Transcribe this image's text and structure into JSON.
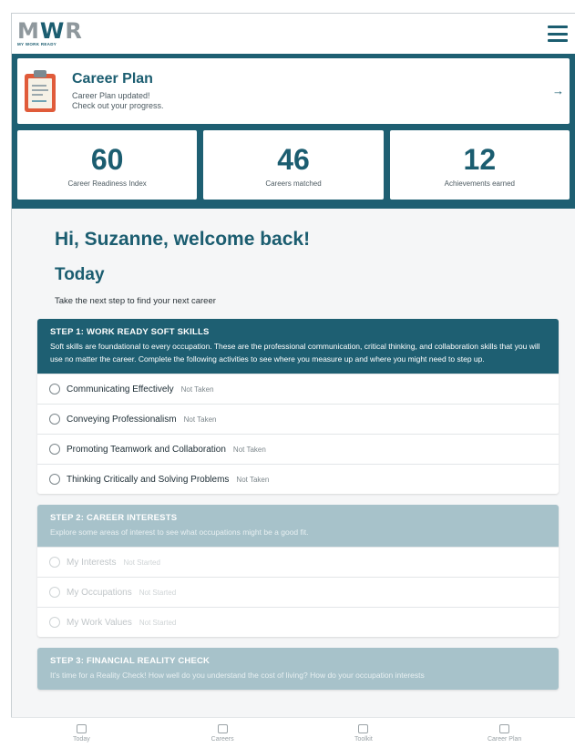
{
  "header": {
    "logo_mark_m": "M",
    "logo_mark_w": "W",
    "logo_mark_r": "R",
    "logo_sub": "MY WORK READY",
    "menu_icon": "hamburger-icon"
  },
  "career_plan": {
    "title": "Career Plan",
    "line1": "Career Plan updated!",
    "line2": "Check out your progress.",
    "arrow": "→"
  },
  "stats": [
    {
      "value": "60",
      "label": "Career Readiness Index"
    },
    {
      "value": "46",
      "label": "Careers matched"
    },
    {
      "value": "12",
      "label": "Achievements earned"
    }
  ],
  "greeting": "Hi, Suzanne, welcome back!",
  "today": {
    "title": "Today",
    "subtitle": "Take the next step to find your next career"
  },
  "steps": [
    {
      "title": "STEP 1: WORK READY SOFT SKILLS",
      "description": "Soft skills are foundational to every occupation. These are the professional communication, critical thinking, and collaboration skills that you will use no matter the career. Complete the following activities to see where you measure up and where you might need to step up.",
      "items": [
        {
          "label": "Communicating Effectively",
          "status": "Not Taken"
        },
        {
          "label": "Conveying Professionalism",
          "status": "Not Taken"
        },
        {
          "label": "Promoting Teamwork and Collaboration",
          "status": "Not Taken"
        },
        {
          "label": "Thinking Critically and Solving Problems",
          "status": "Not Taken"
        }
      ]
    },
    {
      "title": "STEP 2: CAREER INTERESTS",
      "description": "Explore some areas of interest to see what occupations might be a good fit.",
      "items": [
        {
          "label": "My Interests",
          "status": "Not Started"
        },
        {
          "label": "My Occupations",
          "status": "Not Started"
        },
        {
          "label": "My Work Values",
          "status": "Not Started"
        }
      ]
    },
    {
      "title": "STEP 3: FINANCIAL REALITY CHECK",
      "description": "It's time for a Reality Check! How well do you understand the cost of living? How do your occupation interests"
    }
  ],
  "bottom_nav": [
    {
      "label": "Today",
      "icon": "home-icon"
    },
    {
      "label": "Careers",
      "icon": "clipboard-icon"
    },
    {
      "label": "Toolkit",
      "icon": "toolkit-icon"
    },
    {
      "label": "Career Plan",
      "icon": "document-icon"
    }
  ],
  "colors": {
    "brand": "#1e5f72",
    "accent": "#e05b3a",
    "faded_header": "#a7c2ca"
  }
}
